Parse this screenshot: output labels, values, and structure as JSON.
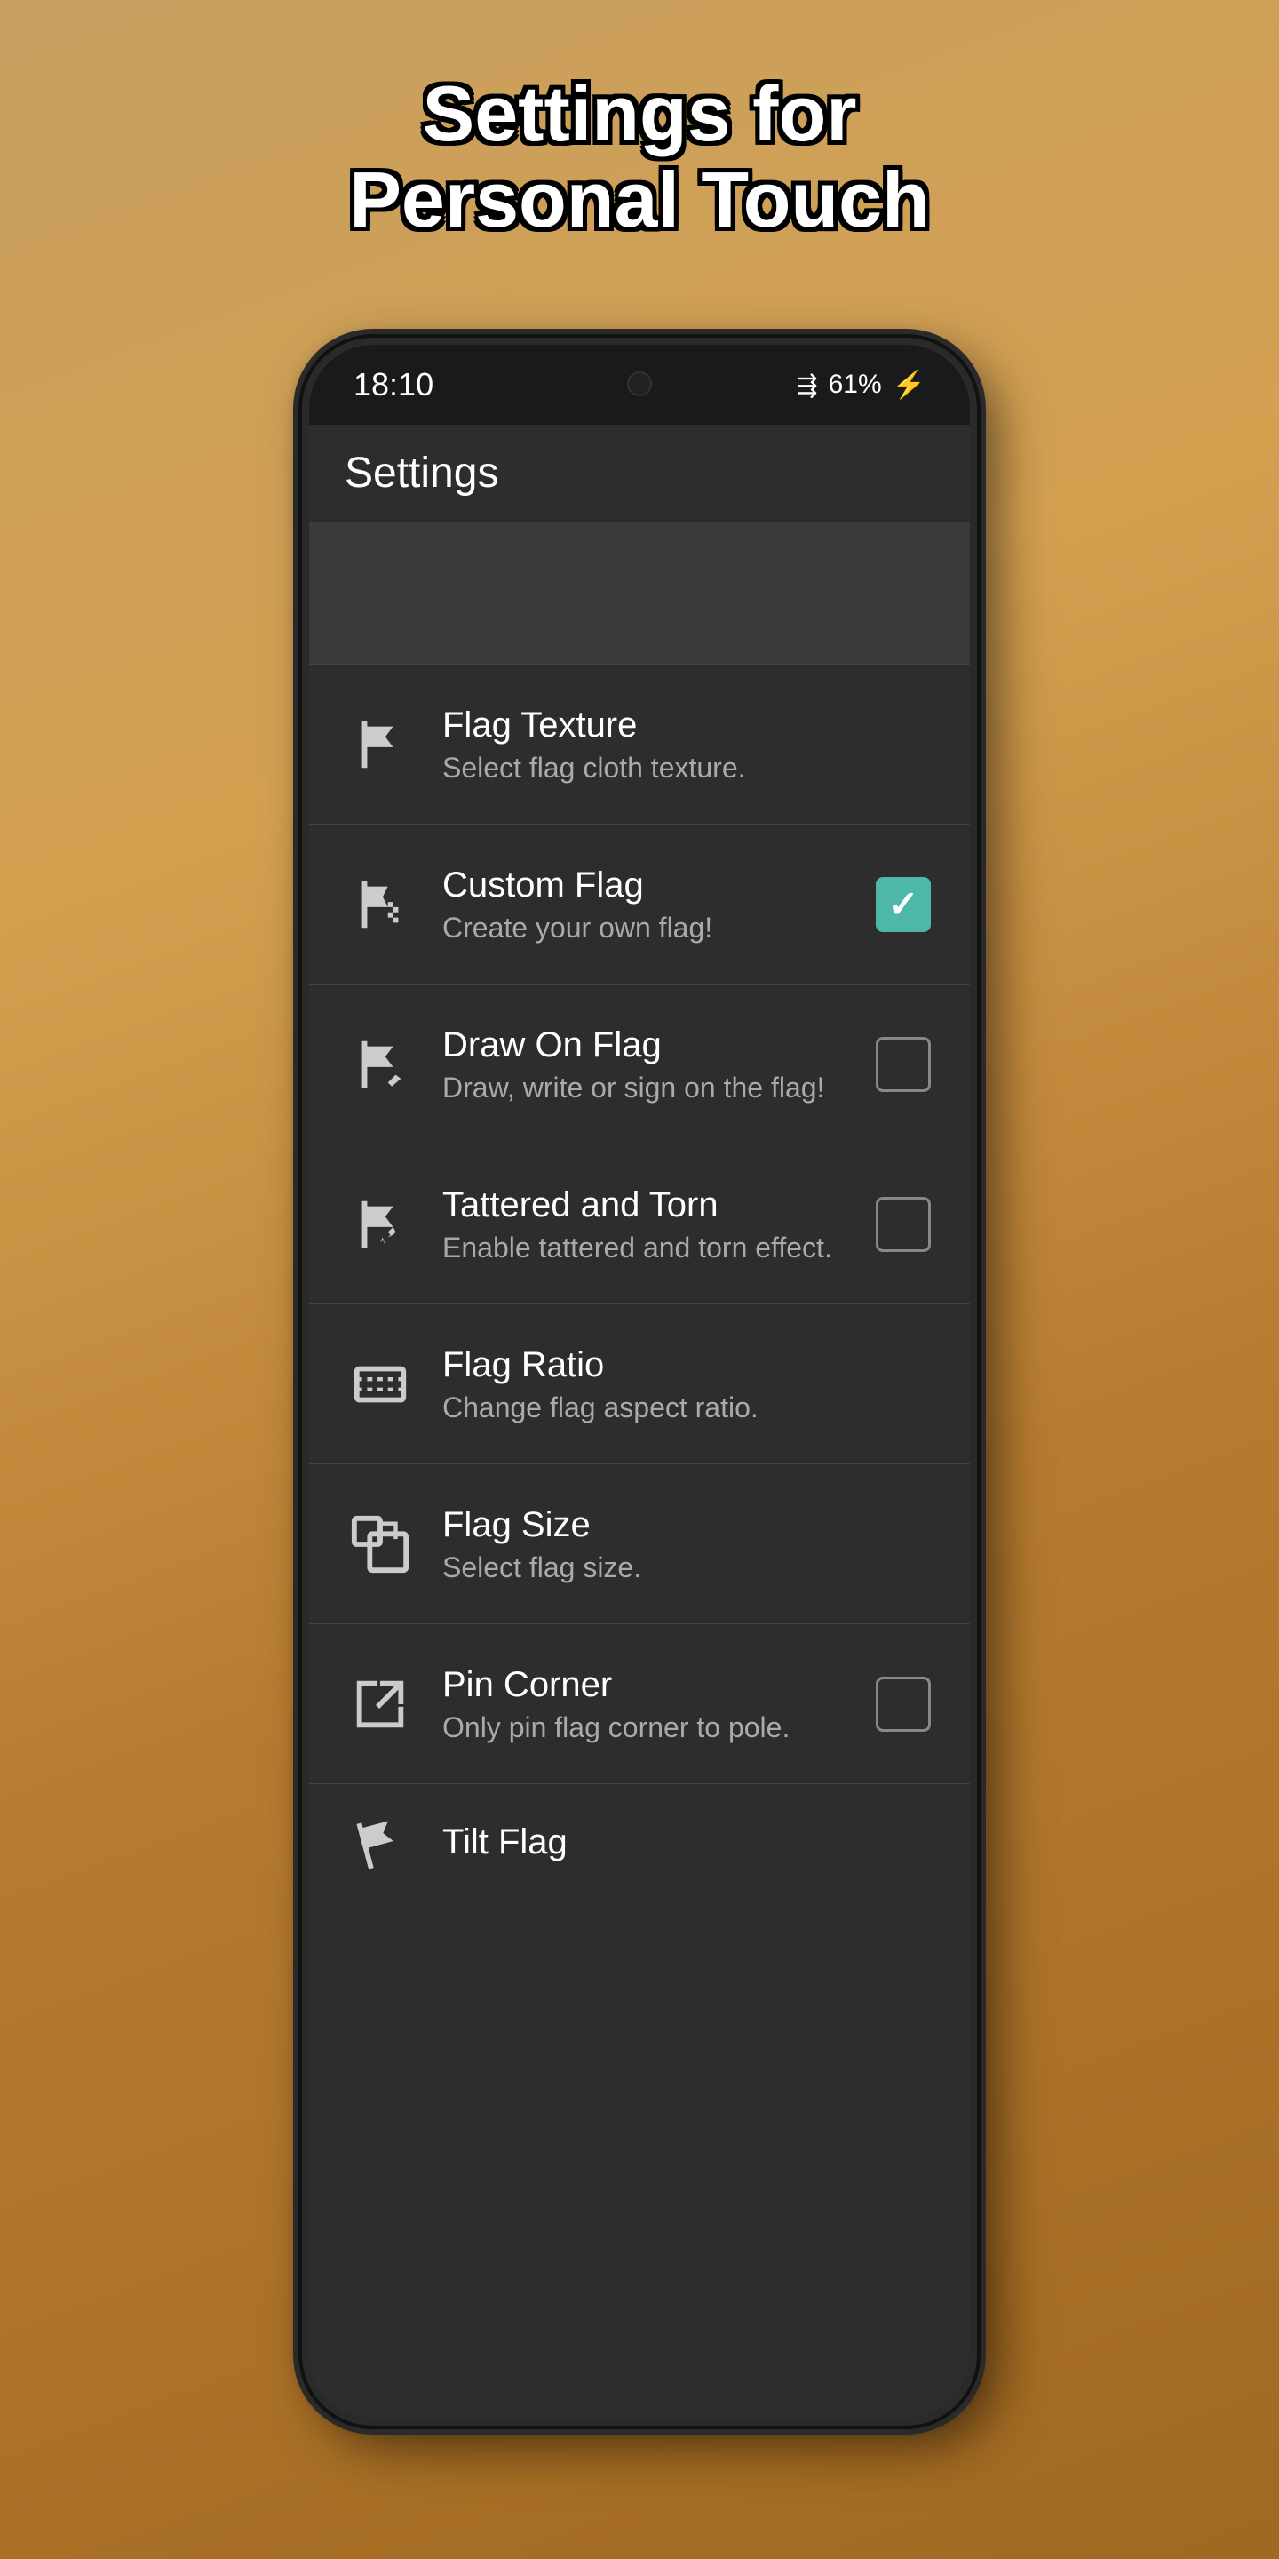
{
  "page": {
    "title_line1": "Settings for",
    "title_line2": "Personal Touch"
  },
  "status_bar": {
    "time": "18:10",
    "battery": "61%",
    "battery_icon": "⚡"
  },
  "app_bar": {
    "title": "Settings"
  },
  "settings_items": [
    {
      "id": "flag-texture",
      "title": "Flag Texture",
      "subtitle": "Select flag cloth texture.",
      "has_checkbox": false,
      "checked": false
    },
    {
      "id": "custom-flag",
      "title": "Custom Flag",
      "subtitle": "Create your own flag!",
      "has_checkbox": true,
      "checked": true
    },
    {
      "id": "draw-on-flag",
      "title": "Draw On Flag",
      "subtitle": "Draw, write or sign on the flag!",
      "has_checkbox": true,
      "checked": false
    },
    {
      "id": "tattered-and-torn",
      "title": "Tattered and Torn",
      "subtitle": "Enable tattered and torn effect.",
      "has_checkbox": true,
      "checked": false
    },
    {
      "id": "flag-ratio",
      "title": "Flag Ratio",
      "subtitle": "Change flag aspect ratio.",
      "has_checkbox": false,
      "checked": false
    },
    {
      "id": "flag-size",
      "title": "Flag Size",
      "subtitle": "Select flag size.",
      "has_checkbox": false,
      "checked": false
    },
    {
      "id": "pin-corner",
      "title": "Pin Corner",
      "subtitle": "Only pin flag corner to pole.",
      "has_checkbox": true,
      "checked": false
    },
    {
      "id": "tilt-flag",
      "title": "Tilt Flag",
      "subtitle": "",
      "has_checkbox": false,
      "checked": false,
      "partial": true
    }
  ],
  "colors": {
    "checked": "#4db8a8",
    "background": "#2d2d2d",
    "text_primary": "#ffffff",
    "text_secondary": "#aaaaaa"
  }
}
